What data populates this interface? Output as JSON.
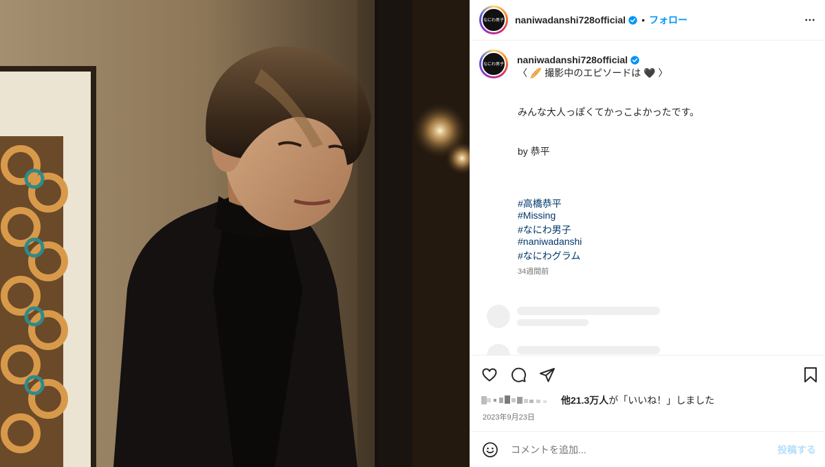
{
  "account": {
    "username": "naniwadanshi728official",
    "avatar_text": "なにわ男子",
    "verified": true
  },
  "header": {
    "separator": "•",
    "follow_label": "フォロー",
    "more_icon": "more-horizontal-icon"
  },
  "caption": {
    "line1": "〈 🥖 撮影中のエピソードは 🖤 〉",
    "line2": "みんな大人っぽくてかっこよかったです。",
    "line3": "by 恭平",
    "hashtags": [
      "#高橋恭平",
      "#Missing",
      "#なにわ男子",
      "#naniwadanshi",
      "#なにわグラム"
    ],
    "time_ago": "34週間前"
  },
  "actions": {
    "like_icon": "heart-icon",
    "comment_icon": "comment-icon",
    "share_icon": "share-icon",
    "save_icon": "bookmark-icon"
  },
  "likes": {
    "count_text": "他21.3万人",
    "suffix_text": "が「いいね！」しました"
  },
  "post_date": "2023年9月23日",
  "comment": {
    "emoji_icon": "smiley-icon",
    "placeholder": "コメントを追加...",
    "post_label": "投稿する"
  },
  "colors": {
    "accent": "#0095f6",
    "hashtag": "#00376b",
    "muted": "#737373",
    "post_disabled": "#b2dffc"
  }
}
